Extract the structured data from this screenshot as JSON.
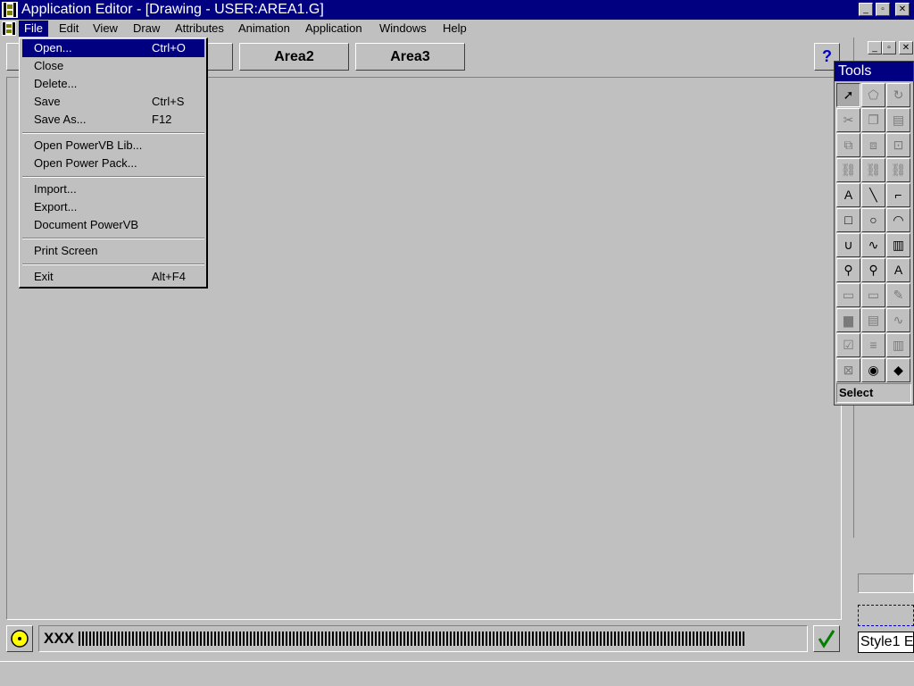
{
  "window": {
    "title": "Application Editor - [Drawing - USER:AREA1.G]",
    "minimize_glyph": "_",
    "restore_glyph": "▫",
    "close_glyph": "✕"
  },
  "menubar": {
    "items": [
      {
        "label": "File"
      },
      {
        "label": "Edit"
      },
      {
        "label": "View"
      },
      {
        "label": "Draw"
      },
      {
        "label": "Attributes"
      },
      {
        "label": "Animation"
      },
      {
        "label": "Application"
      },
      {
        "label": "Windows"
      },
      {
        "label": "Help"
      }
    ]
  },
  "file_menu": {
    "items": [
      {
        "label": "Open...",
        "accel": "Ctrl+O"
      },
      {
        "label": "Close",
        "accel": ""
      },
      {
        "label": "Delete...",
        "accel": ""
      },
      {
        "label": "Save",
        "accel": "Ctrl+S"
      },
      {
        "label": "Save As...",
        "accel": "F12"
      },
      {
        "label": "Open PowerVB Lib...",
        "accel": ""
      },
      {
        "label": "Open Power Pack...",
        "accel": ""
      },
      {
        "label": "Import...",
        "accel": ""
      },
      {
        "label": "Export...",
        "accel": ""
      },
      {
        "label": "Document PowerVB",
        "accel": ""
      },
      {
        "label": "Print Screen",
        "accel": ""
      },
      {
        "label": "Exit",
        "accel": "Alt+F4"
      }
    ]
  },
  "area_tabs": [
    {
      "label": "Area2"
    },
    {
      "label": "Area3"
    }
  ],
  "help_button": {
    "label": "?"
  },
  "tools": {
    "title": "Tools",
    "status": "Select",
    "icons": [
      {
        "name": "select-arrow",
        "glyph": "➚"
      },
      {
        "name": "reshape",
        "glyph": "⬠"
      },
      {
        "name": "rotate",
        "glyph": "↻"
      },
      {
        "name": "cut",
        "glyph": "✂"
      },
      {
        "name": "copy",
        "glyph": "❐"
      },
      {
        "name": "paste",
        "glyph": "▤"
      },
      {
        "name": "group",
        "glyph": "⧉"
      },
      {
        "name": "ungroup",
        "glyph": "⧈"
      },
      {
        "name": "arrange",
        "glyph": "⊡"
      },
      {
        "name": "link-1",
        "glyph": "⛓"
      },
      {
        "name": "link-2",
        "glyph": "⛓"
      },
      {
        "name": "link-3",
        "glyph": "⛓"
      },
      {
        "name": "text",
        "glyph": "A"
      },
      {
        "name": "line",
        "glyph": "╲"
      },
      {
        "name": "polyline",
        "glyph": "⌐"
      },
      {
        "name": "rectangle",
        "glyph": "□"
      },
      {
        "name": "ellipse",
        "glyph": "○"
      },
      {
        "name": "arc",
        "glyph": "◠"
      },
      {
        "name": "curve",
        "glyph": "∪"
      },
      {
        "name": "spline",
        "glyph": "∿"
      },
      {
        "name": "chart",
        "glyph": "▥"
      },
      {
        "name": "line-style",
        "glyph": "⚲"
      },
      {
        "name": "fill-style",
        "glyph": "⚲"
      },
      {
        "name": "text-style",
        "glyph": "A"
      },
      {
        "name": "text-field",
        "glyph": "▭"
      },
      {
        "name": "input-field",
        "glyph": "▭"
      },
      {
        "name": "pen",
        "glyph": "✎"
      },
      {
        "name": "bar-graph",
        "glyph": "▆"
      },
      {
        "name": "filmstrip",
        "glyph": "▤"
      },
      {
        "name": "trend",
        "glyph": "∿"
      },
      {
        "name": "ok-button",
        "glyph": "☑"
      },
      {
        "name": "list",
        "glyph": "≡"
      },
      {
        "name": "slider",
        "glyph": "▥"
      },
      {
        "name": "variable",
        "glyph": "⊠"
      },
      {
        "name": "camera",
        "glyph": "◉"
      },
      {
        "name": "eraser",
        "glyph": "◆"
      }
    ]
  },
  "status_bar": {
    "text": "XXX",
    "check_glyph": "✓"
  },
  "style_field": {
    "text": "Style1 E"
  },
  "colors": {
    "title_bar": "#000080",
    "face": "#c0c0c0",
    "highlight": "#000080",
    "check": "#008000",
    "help": "#0000c0"
  }
}
